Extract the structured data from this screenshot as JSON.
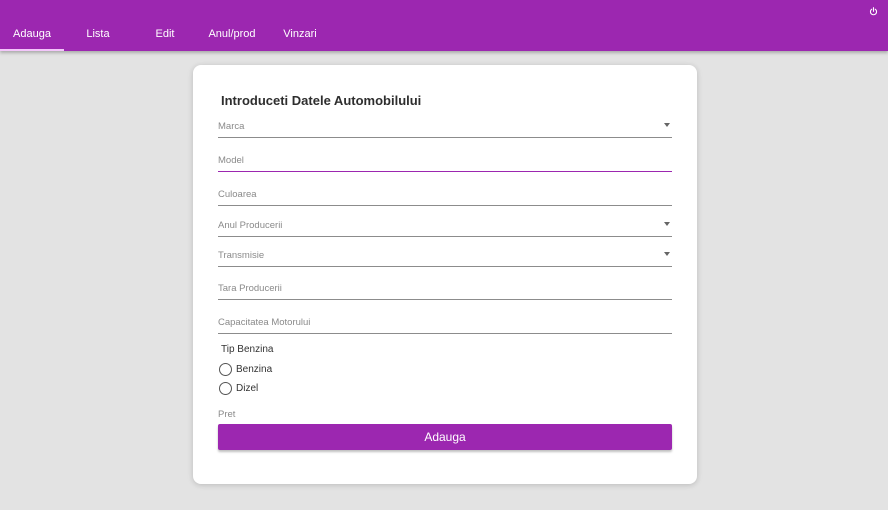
{
  "nav": {
    "tabs": [
      {
        "label": "Adauga",
        "active": true
      },
      {
        "label": "Lista"
      },
      {
        "label": "Edit"
      },
      {
        "label": "Anul/prod"
      },
      {
        "label": "Vinzari"
      }
    ],
    "power_icon": "power-icon"
  },
  "form": {
    "title": "Introduceti Datele Automobilului",
    "fields": {
      "marca": {
        "placeholder": "Marca",
        "type": "select"
      },
      "model": {
        "placeholder": "Model",
        "type": "text",
        "focused": true
      },
      "culoarea": {
        "placeholder": "Culoarea",
        "type": "text"
      },
      "anul": {
        "placeholder": "Anul Producerii",
        "type": "select"
      },
      "transmisie": {
        "placeholder": "Transmisie",
        "type": "select"
      },
      "tara": {
        "placeholder": "Tara Producerii",
        "type": "text"
      },
      "capacitatea": {
        "placeholder": "Capacitatea Motorului",
        "type": "text"
      }
    },
    "fuel": {
      "label": "Tip Benzina",
      "options": [
        "Benzina",
        "Dizel"
      ]
    },
    "price_label": "Pret",
    "submit_label": "Adauga"
  },
  "colors": {
    "accent": "#9c27b0",
    "background": "#e3e3e3",
    "card": "#ffffff"
  }
}
